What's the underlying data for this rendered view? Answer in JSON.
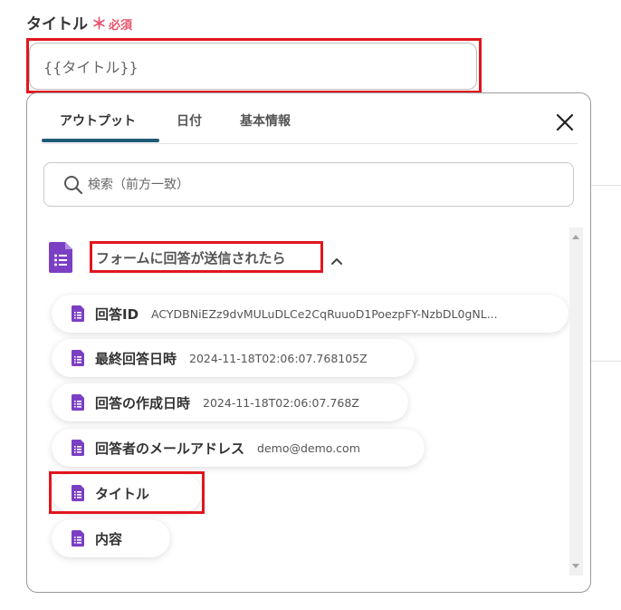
{
  "field": {
    "label": "タイトル",
    "required_star": "＊",
    "required_text": "必須",
    "value": "{{タイトル}}"
  },
  "popup": {
    "tabs": [
      {
        "label": "アウトプット",
        "active": true
      },
      {
        "label": "日付",
        "active": false
      },
      {
        "label": "基本情報",
        "active": false
      }
    ],
    "search_placeholder": "検索（前方一致）",
    "group": {
      "title": "フォームに回答が送信されたら",
      "expanded": true,
      "items": [
        {
          "name": "回答ID",
          "value": "ACYDBNiEZz9dvMULuDLCe2CqRuuoD1PoezpFY-NzbDL0gNL..."
        },
        {
          "name": "最終回答日時",
          "value": "2024-11-18T02:06:07.768105Z"
        },
        {
          "name": "回答の作成日時",
          "value": "2024-11-18T02:06:07.768Z"
        },
        {
          "name": "回答者のメールアドレス",
          "value": "demo@demo.com"
        },
        {
          "name": "タイトル",
          "value": ""
        },
        {
          "name": "内容",
          "value": ""
        }
      ]
    }
  },
  "colors": {
    "accent_tab": "#1f5a77",
    "forms_purple": "#7b3fc4",
    "required": "#e8536b",
    "highlight": "#e0161e"
  },
  "icons": {
    "group": "google-forms-icon",
    "item": "form-doc-icon",
    "search": "search-icon",
    "close": "close-icon",
    "collapse": "chevron-up-icon"
  }
}
